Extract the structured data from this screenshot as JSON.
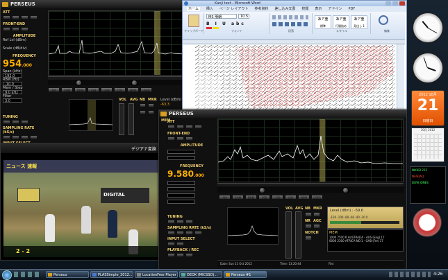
{
  "win1": {
    "title": "PERSEUS",
    "att_label": "ATT",
    "frontend_label": "FRONT-END",
    "amplitude_label": "AMPLITUDE",
    "frequency_label": "FREQUENCY",
    "freq_main": "954",
    "freq_dec": ".000",
    "sampling_label": "SAMPLING RATE (kS/s)",
    "input_label": "INPUT SELECT",
    "tuning_label": "TUNING",
    "small_fields": [
      "Ref Lvl (dBm)",
      "Scale (dB/div)",
      "Span (kHz)",
      "RBW (Hz)",
      "Mem / Step",
      "Filter"
    ],
    "field_values": [
      "-10.0",
      "10",
      "192.0",
      "5.0",
      "9.0 kHz",
      "3.0"
    ],
    "modes": [
      "AM",
      "SAM",
      "DRM",
      "LSB",
      "USB",
      "CW",
      "NFM",
      "USER"
    ],
    "labels_mid": [
      "VOL",
      "AVG",
      "NB",
      "MKR",
      "Level (dBm)"
    ],
    "level_value": "-63.3"
  },
  "word": {
    "title": "Kanji text - Microsoft Word",
    "tabs": [
      "ホーム",
      "挿入",
      "ページ レイアウト",
      "参考資料",
      "差し込み文書",
      "校閲",
      "表示",
      "アドイン",
      "PDF"
    ],
    "font_name": "MS 明朝",
    "font_size": "10.5",
    "groups": [
      "クリップボード",
      "フォント",
      "段落",
      "スタイル",
      "編集"
    ],
    "styles": [
      "標準",
      "行間詰め",
      "見出し 1"
    ],
    "style_glyph": "あア亜"
  },
  "video": {
    "title": "デジアナ変換",
    "banner": "ニュース 速報",
    "scoreboard": "2 - 2",
    "logo_text": "DIGITAL"
  },
  "win2": {
    "title": "PERSEUS",
    "mem_label": "MEM",
    "att_label": "ATT",
    "frontend_label": "FRONT-END",
    "amplitude_label": "AMPLITUDE",
    "frequency_label": "FREQUENCY",
    "freq_main": "9.580",
    "freq_dec": ".000",
    "tuning_label": "TUNING",
    "sampling_label": "SAMPLING RATE (kS/s)",
    "input_label": "INPUT SELECT",
    "playback_label": "PLAYBACK / REC",
    "modes": [
      "AM",
      "SAM",
      "DRM",
      "LSB",
      "USB",
      "CW",
      "NFM",
      "USER"
    ],
    "labels_mid": [
      "VOL",
      "AVG",
      "NB",
      "MKR",
      "NR",
      "AGC",
      "NOTCH"
    ],
    "level_label": "Level (dBm) : -59.6",
    "meter_scale": "-120 -100 -80 -60 -40 -20 0",
    "mem_lines": [
      "1000 7500 R.AUSTRALIA - AUS (Eng)  17",
      "0000 2300 AFRICA NO.1 - GAB (Fre)  17"
    ],
    "status": [
      "Date: Sun 21 Oct 2012",
      "Time: 13:20:44",
      "File:"
    ]
  },
  "sidebar": {
    "calendar_month": "2012 10月",
    "calendar_day": "21",
    "calendar_weekday": "日曜日",
    "mini_cal_title": "10月 2012",
    "ticker_lines": [
      "NIKKEI 225",
      "NASDAQ",
      "DOW JONES"
    ]
  },
  "taskbar": {
    "items": [
      "Perseus",
      "PLASSimple_2012...",
      "LocationFree Player",
      "DEOK (MICSSO)...",
      "Perseus #1"
    ],
    "clock": "4:26"
  }
}
